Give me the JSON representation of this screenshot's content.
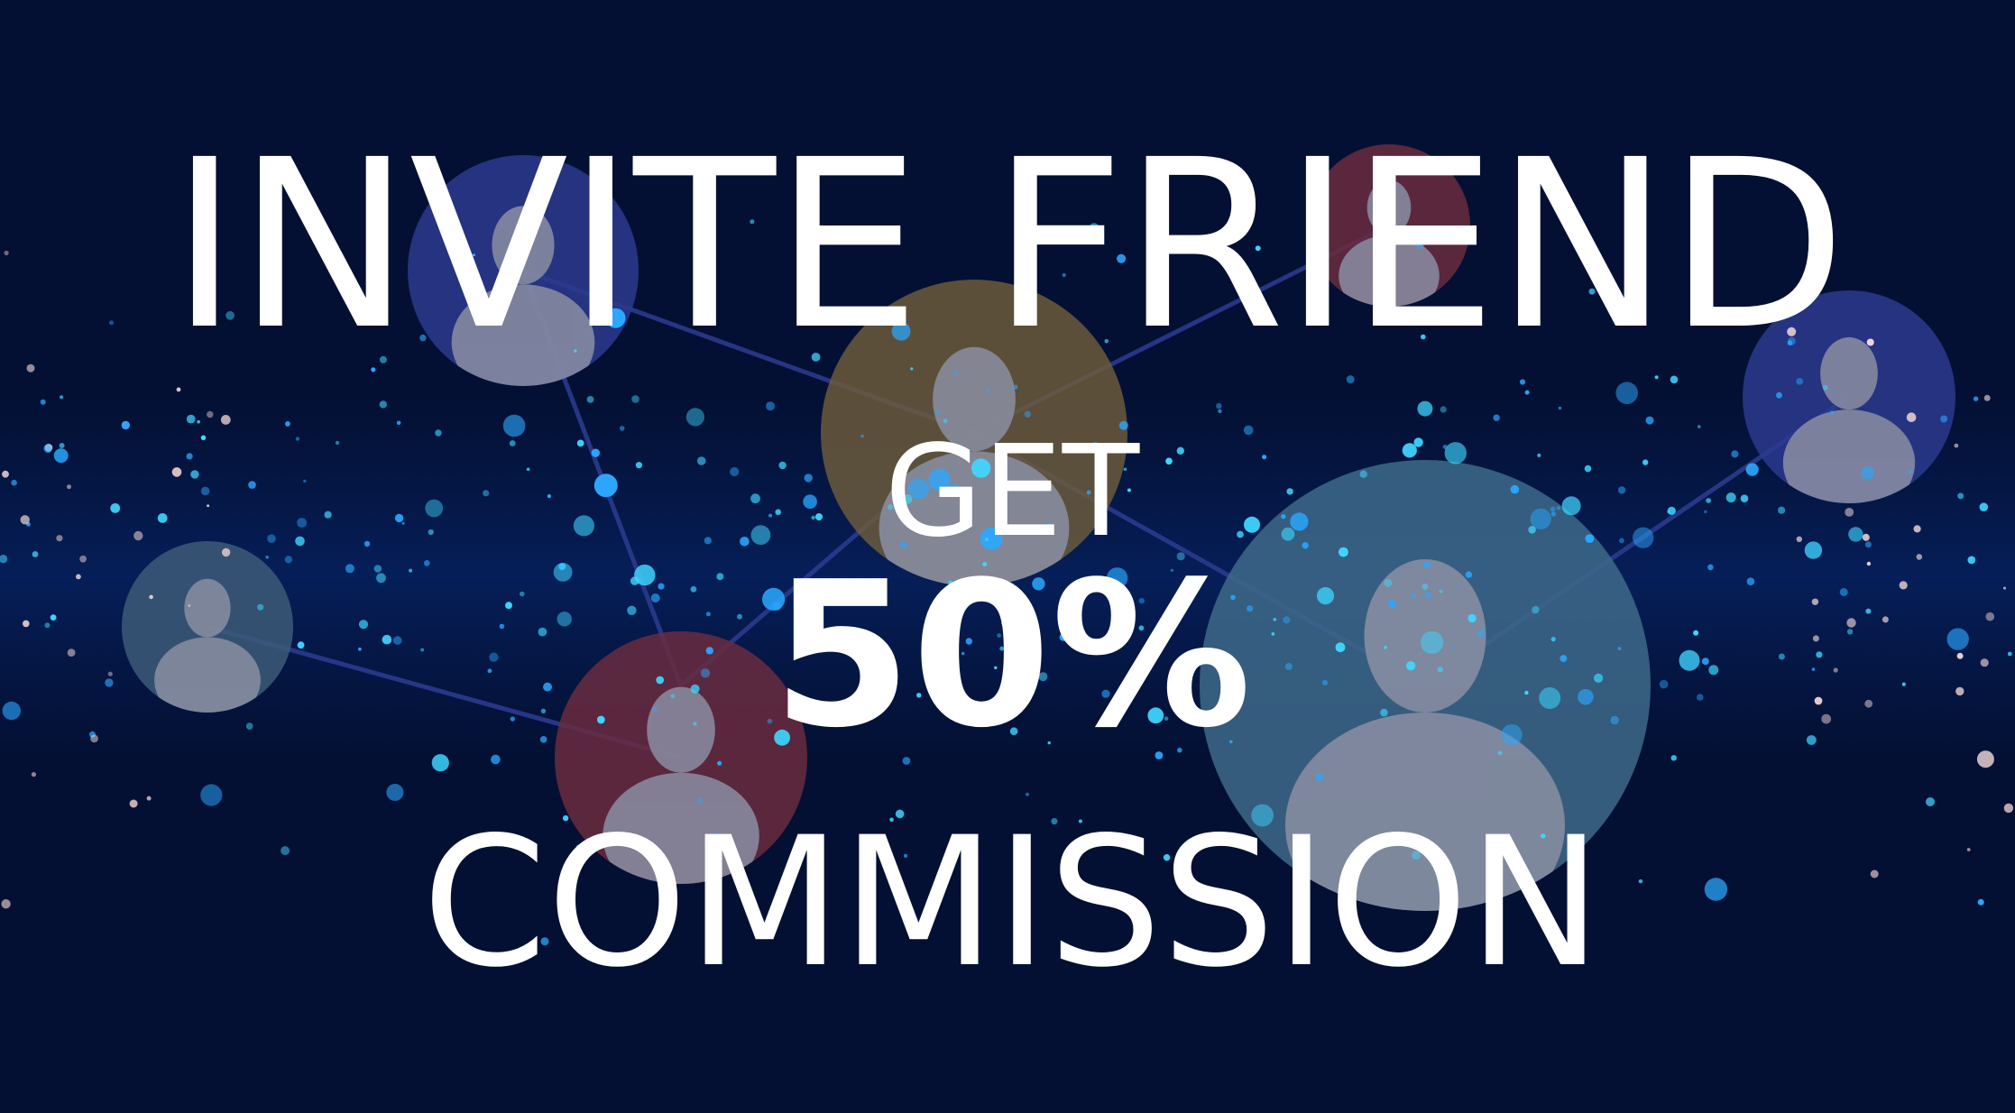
{
  "banner": {
    "title": "INVITE FRIEND",
    "get": "GET",
    "percent": "50%",
    "commission": "COMMISSION"
  },
  "colors": {
    "background": "#031033",
    "text": "#ffffff",
    "glow_red": "#b8303a",
    "particle": "#3fd6ff",
    "connection_line": "#2a3a8c"
  },
  "icons": [
    "person-icon",
    "network-link",
    "particle"
  ]
}
